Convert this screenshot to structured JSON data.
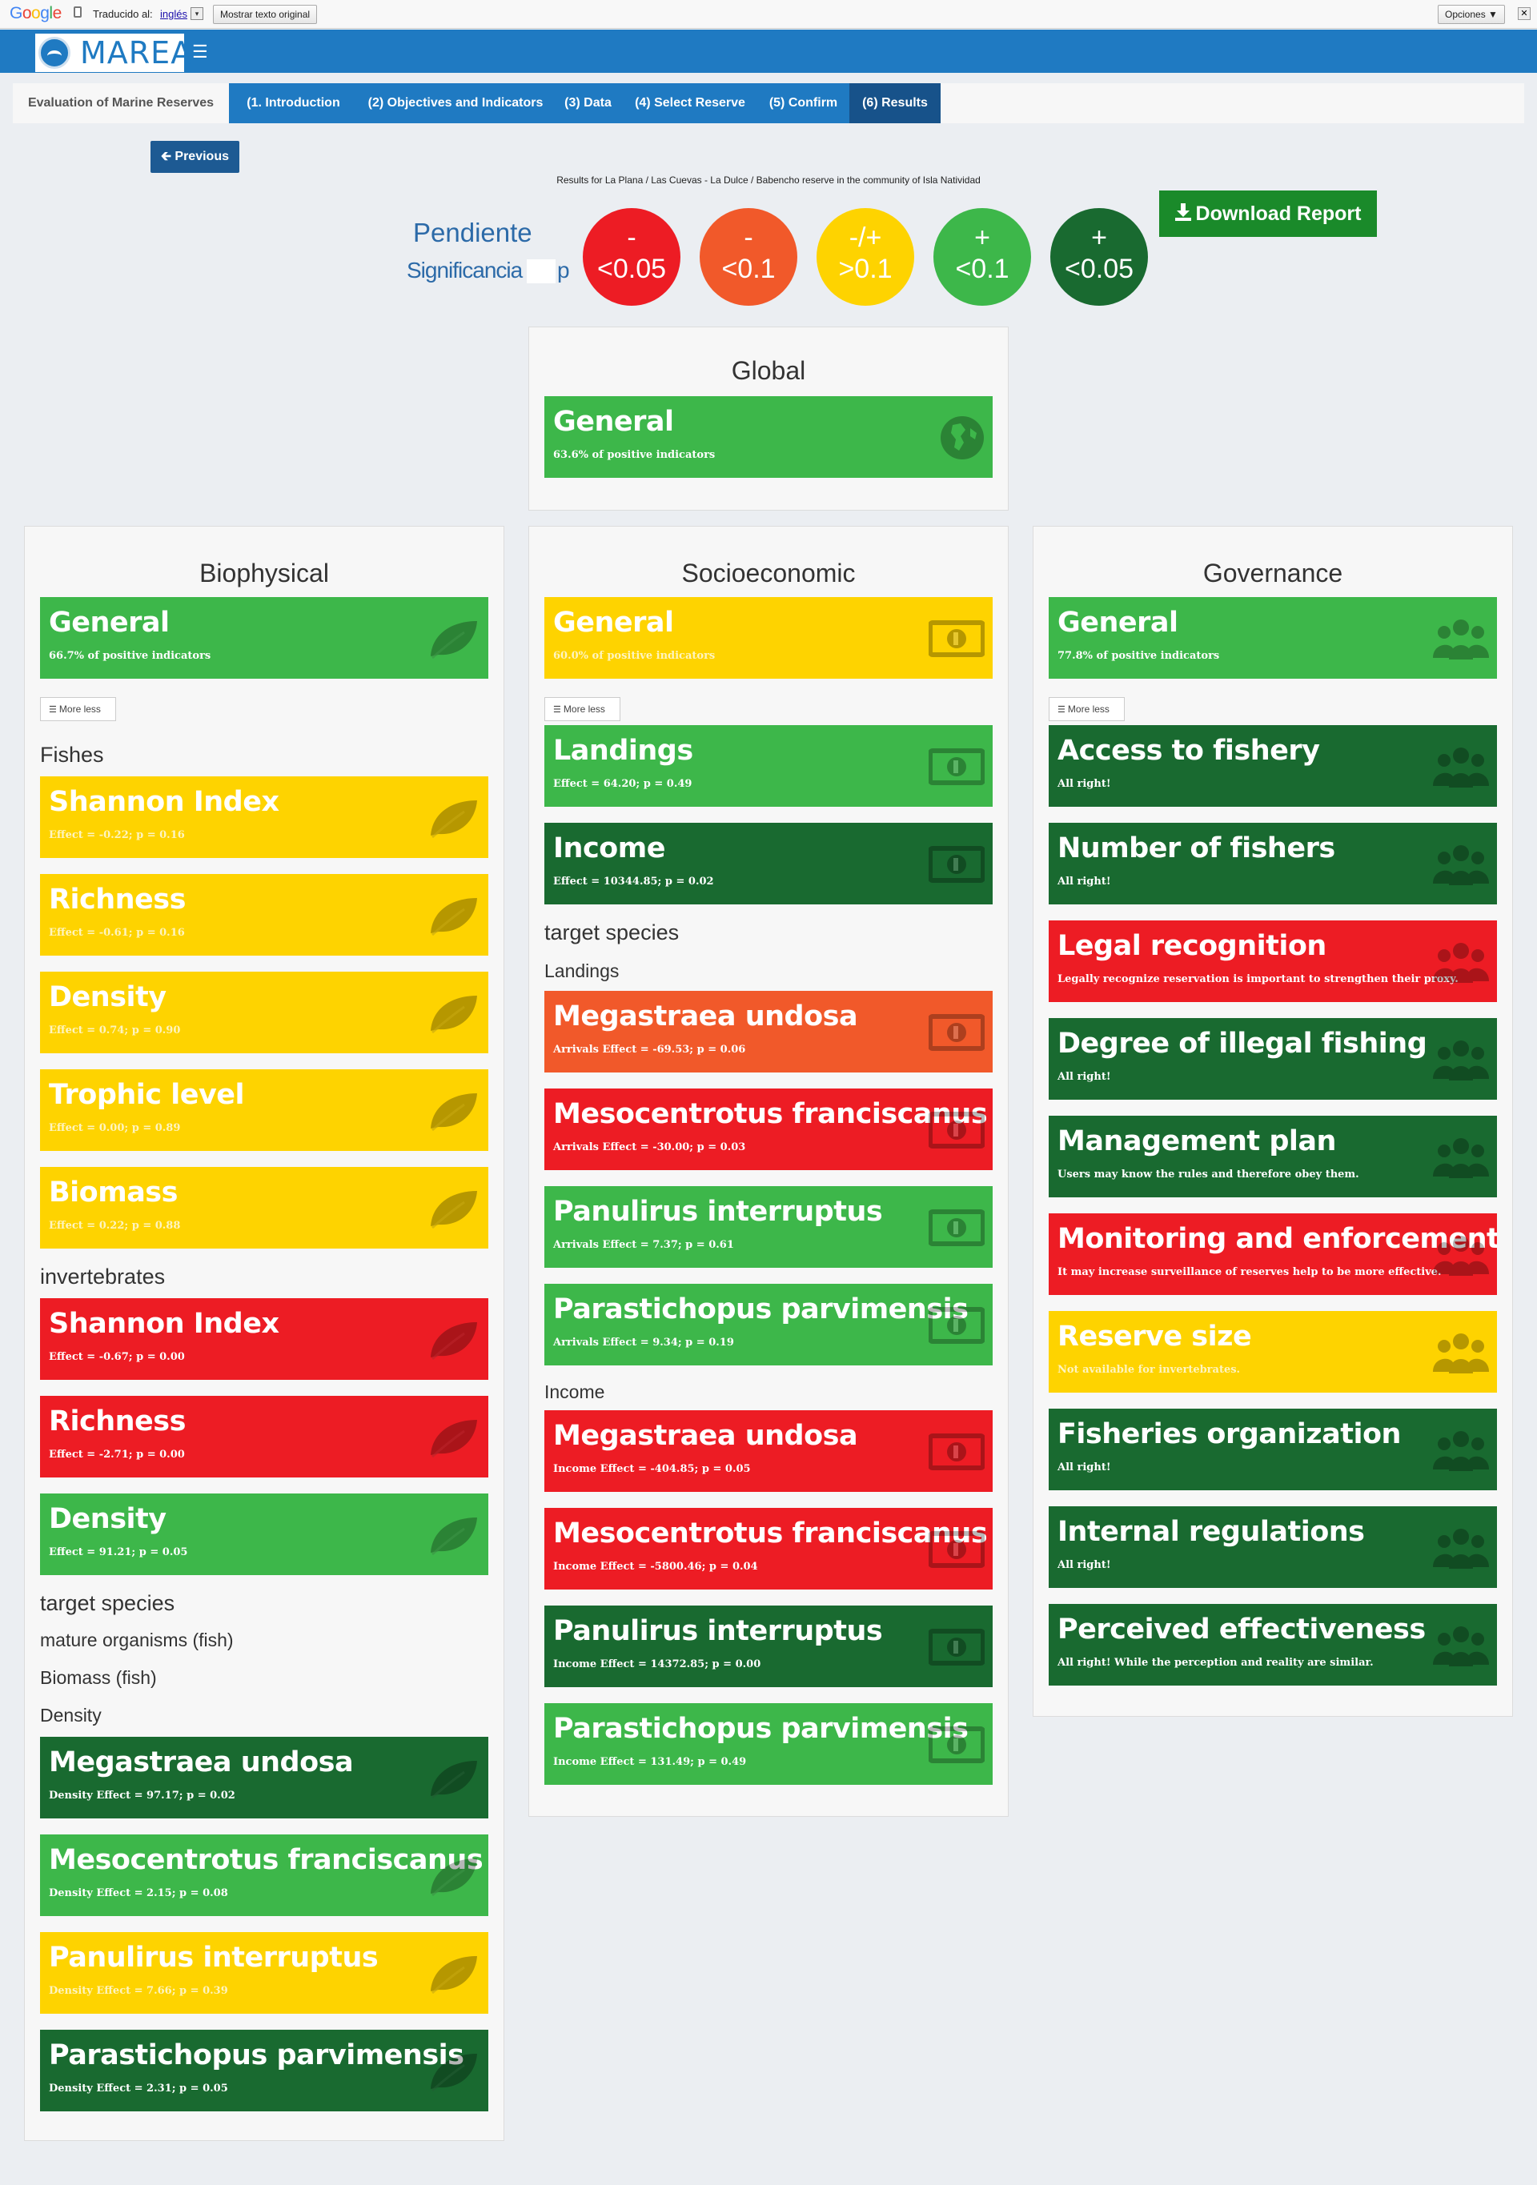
{
  "translate_bar": {
    "google": "Google",
    "translated_to": "Traducido al:",
    "language": "inglés",
    "show_original": "Mostrar texto original",
    "options": "Opciones ▼",
    "close": "✕"
  },
  "header": {
    "brand": "MAREA",
    "menu_icon": "☰"
  },
  "tabs": [
    {
      "label": "Evaluation of Marine Reserves"
    },
    {
      "label": "(1. Introduction"
    },
    {
      "label": "(2) Objectives and Indicators"
    },
    {
      "label": "(3) Data"
    },
    {
      "label": "(4) Select Reserve"
    },
    {
      "label": "(5) Confirm"
    },
    {
      "label": "(6) Results"
    }
  ],
  "previous_button": "🡰 Previous",
  "results_for": "Results for La Plana / Las Cuevas - La Dulce / Babencho reserve in the community of Isla Natividad",
  "legend": {
    "slope_label": "Pendiente",
    "significance_label": "Significancia",
    "p_label": "p",
    "circles": [
      {
        "sign": "-",
        "value": "<0.05",
        "color": "#ed1c24"
      },
      {
        "sign": "-",
        "value": "<0.1",
        "color": "#f1592a"
      },
      {
        "sign": "-/+",
        "value": ">0.1",
        "color": "#fed300"
      },
      {
        "sign": "+",
        "value": "<0.1",
        "color": "#3db74a"
      },
      {
        "sign": "+",
        "value": "<0.05",
        "color": "#196a30"
      }
    ]
  },
  "download_button": "Download Report",
  "global": {
    "title": "Global",
    "card": {
      "title": "General",
      "sub": "63.6% of positive indicators"
    }
  },
  "biophysical": {
    "title": "Biophysical",
    "general": {
      "title": "General",
      "sub": "66.7% of positive indicators"
    },
    "more_less": "More less",
    "fishes_label": "Fishes",
    "fishes": [
      {
        "title": "Shannon Index",
        "sub": "Effect = -0.22; p = 0.16"
      },
      {
        "title": "Richness",
        "sub": "Effect = -0.61; p = 0.16"
      },
      {
        "title": "Density",
        "sub": "Effect = 0.74; p = 0.90"
      },
      {
        "title": "Trophic level",
        "sub": "Effect = 0.00; p = 0.89"
      },
      {
        "title": "Biomass",
        "sub": "Effect = 0.22; p = 0.88"
      }
    ],
    "invertebrates_label": "invertebrates",
    "invertebrates": [
      {
        "title": "Shannon Index",
        "sub": "Effect = -0.67; p = 0.00"
      },
      {
        "title": "Richness",
        "sub": "Effect = -2.71; p = 0.00"
      },
      {
        "title": "Density",
        "sub": "Effect = 91.21; p = 0.05"
      }
    ],
    "target_label": "target species",
    "mature_label": "mature organisms (fish)",
    "biomass_label": "Biomass (fish)",
    "density_label": "Density",
    "density_species": [
      {
        "title": "Megastraea undosa",
        "sub": "Density Effect = 97.17; p = 0.02"
      },
      {
        "title": "Mesocentrotus franciscanus",
        "sub": "Density Effect = 2.15; p = 0.08"
      },
      {
        "title": "Panulirus interruptus",
        "sub": "Density Effect = 7.66; p = 0.39"
      },
      {
        "title": "Parastichopus parvimensis",
        "sub": "Density Effect = 2.31; p = 0.05"
      }
    ]
  },
  "socioeconomic": {
    "title": "Socioeconomic",
    "general": {
      "title": "General",
      "sub": "60.0% of positive indicators"
    },
    "more_less": "More less",
    "landings": {
      "title": "Landings",
      "sub": "Effect = 64.20; p = 0.49"
    },
    "income": {
      "title": "Income",
      "sub": "Effect = 10344.85; p = 0.02"
    },
    "target_label": "target species",
    "landings_label": "Landings",
    "landings_species": [
      {
        "title": "Megastraea undosa",
        "sub": "Arrivals Effect = -69.53; p = 0.06"
      },
      {
        "title": "Mesocentrotus franciscanus",
        "sub": "Arrivals Effect = -30.00; p = 0.03"
      },
      {
        "title": "Panulirus interruptus",
        "sub": "Arrivals Effect = 7.37; p = 0.61"
      },
      {
        "title": "Parastichopus parvimensis",
        "sub": "Arrivals Effect = 9.34; p = 0.19"
      }
    ],
    "income_label": "Income",
    "income_species": [
      {
        "title": "Megastraea undosa",
        "sub": "Income Effect = -404.85; p = 0.05"
      },
      {
        "title": "Mesocentrotus franciscanus",
        "sub": "Income Effect = -5800.46; p = 0.04"
      },
      {
        "title": "Panulirus interruptus",
        "sub": "Income Effect = 14372.85; p = 0.00"
      },
      {
        "title": "Parastichopus parvimensis",
        "sub": "Income Effect = 131.49; p = 0.49"
      }
    ]
  },
  "governance": {
    "title": "Governance",
    "general": {
      "title": "General",
      "sub": "77.8% of positive indicators"
    },
    "more_less": "More less",
    "items": [
      {
        "title": "Access to fishery",
        "sub": "All right!"
      },
      {
        "title": "Number of fishers",
        "sub": "All right!"
      },
      {
        "title": "Legal recognition",
        "sub": "Legally recognize reservation is important to strengthen their proxy."
      },
      {
        "title": "Degree of illegal fishing",
        "sub": "All right!"
      },
      {
        "title": "Management plan",
        "sub": "Users may know the rules and therefore obey them."
      },
      {
        "title": "Monitoring and enforcement",
        "sub": "It may increase surveillance of reserves help to be more effective."
      },
      {
        "title": "Reserve size",
        "sub": "Not available for invertebrates."
      },
      {
        "title": "Fisheries organization",
        "sub": "All right!"
      },
      {
        "title": "Internal regulations",
        "sub": "All right!"
      },
      {
        "title": "Perceived effectiveness",
        "sub": "All right! While the perception and reality are similar."
      }
    ]
  }
}
